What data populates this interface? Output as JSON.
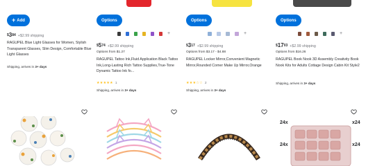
{
  "colors": {
    "accent": "#0071dc",
    "price_text": "#2e2f32",
    "muted": "#74767c",
    "star": "#ffc220"
  },
  "cards": [
    {
      "button_label": "Add",
      "button_icon": "plus-icon",
      "price_dollars": "3",
      "price_cents": "84",
      "price_currency": "$",
      "shipping": "+$2.99 shipping",
      "title": "RAGUPEL Blue Light Glasses for Women, Stylish Transparent Glasses, Slim Design, Comfortable Blue Light Glasses",
      "delivery_prefix": "Shipping, arrives in ",
      "delivery_days": "3+ days"
    },
    {
      "button_label": "Options",
      "price_dollars": "5",
      "price_cents": "74",
      "price_currency": "$",
      "shipping": "+$2.99 shipping",
      "options_from": "Options from $1.27",
      "title": "RAGUPEL Tattoo Ink,Fluid Application Black Tattoo Ink,Long-Lasting Rich Tattoo Supplies,True-Tone Dynamic Tattoo Ink fo...",
      "rating_stars": "★★★★★",
      "rating_count": "1",
      "delivery_prefix": "Shipping, arrives in ",
      "delivery_days": "3+ days"
    },
    {
      "button_label": "Options",
      "price_dollars": "3",
      "price_cents": "17",
      "price_currency": "$",
      "shipping": "+$2.99 shipping",
      "options_from": "Options from $3.17 - $4.88",
      "title": "RAGUPEL Locker Mirror,Convenient Magnetic Mirror,Rounded Corner Make Up Mirror,Orange",
      "rating_stars": "★★★☆☆",
      "rating_count": "2",
      "delivery_prefix": "Shipping, arrives in ",
      "delivery_days": "3+ days"
    },
    {
      "button_label": "Options",
      "price_dollars": "17",
      "price_cents": "03",
      "price_currency": "$",
      "shipping": "+$2.99 shipping",
      "options_from": "Options from $16.26",
      "title": "RAGUPEL Book Nook 3D Assembly Creativity Book Nook Kits for Adults Cottage Design Cabin Kit Style2",
      "delivery_prefix": "Shipping, arrives in ",
      "delivery_days": "3+ days"
    }
  ],
  "swatch_plus": "+",
  "product_row2": {
    "tray_labels": [
      "24x",
      "x24",
      "24x",
      "x24"
    ]
  },
  "icons": [
    "plus-icon",
    "heart-icon"
  ]
}
